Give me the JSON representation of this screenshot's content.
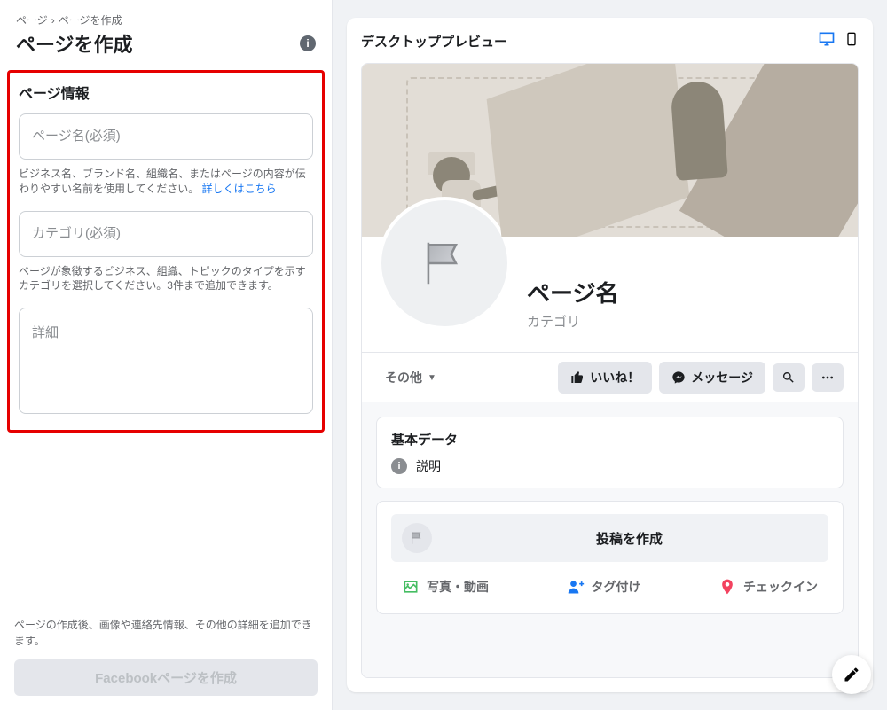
{
  "breadcrumb": {
    "root": "ページ",
    "current": "ページを作成"
  },
  "sidebar": {
    "title": "ページを作成",
    "section_heading": "ページ情報",
    "page_name": {
      "placeholder": "ページ名(必須)",
      "help": "ビジネス名、ブランド名、組織名、またはページの内容が伝わりやすい名前を使用してください。",
      "help_link": "詳しくはこちら"
    },
    "category": {
      "placeholder": "カテゴリ(必須)",
      "help": "ページが象徴するビジネス、組織、トピックのタイプを示すカテゴリを選択してください。3件まで追加できます。"
    },
    "details": {
      "placeholder": "詳細"
    },
    "bottom_help": "ページの作成後、画像や連絡先情報、その他の詳細を追加できます。",
    "create_label": "Facebookページを作成"
  },
  "preview": {
    "title": "デスクトッププレビュー",
    "page_name": "ページ名",
    "category": "カテゴリ",
    "tab_other": "その他",
    "like_label": "いいね！",
    "message_label": "メッセージ",
    "basic_data_heading": "基本データ",
    "basic_data_desc": "説明",
    "compose_title": "投稿を作成",
    "compose_photo": "写真・動画",
    "compose_tag": "タグ付け",
    "compose_checkin": "チェックイン"
  }
}
